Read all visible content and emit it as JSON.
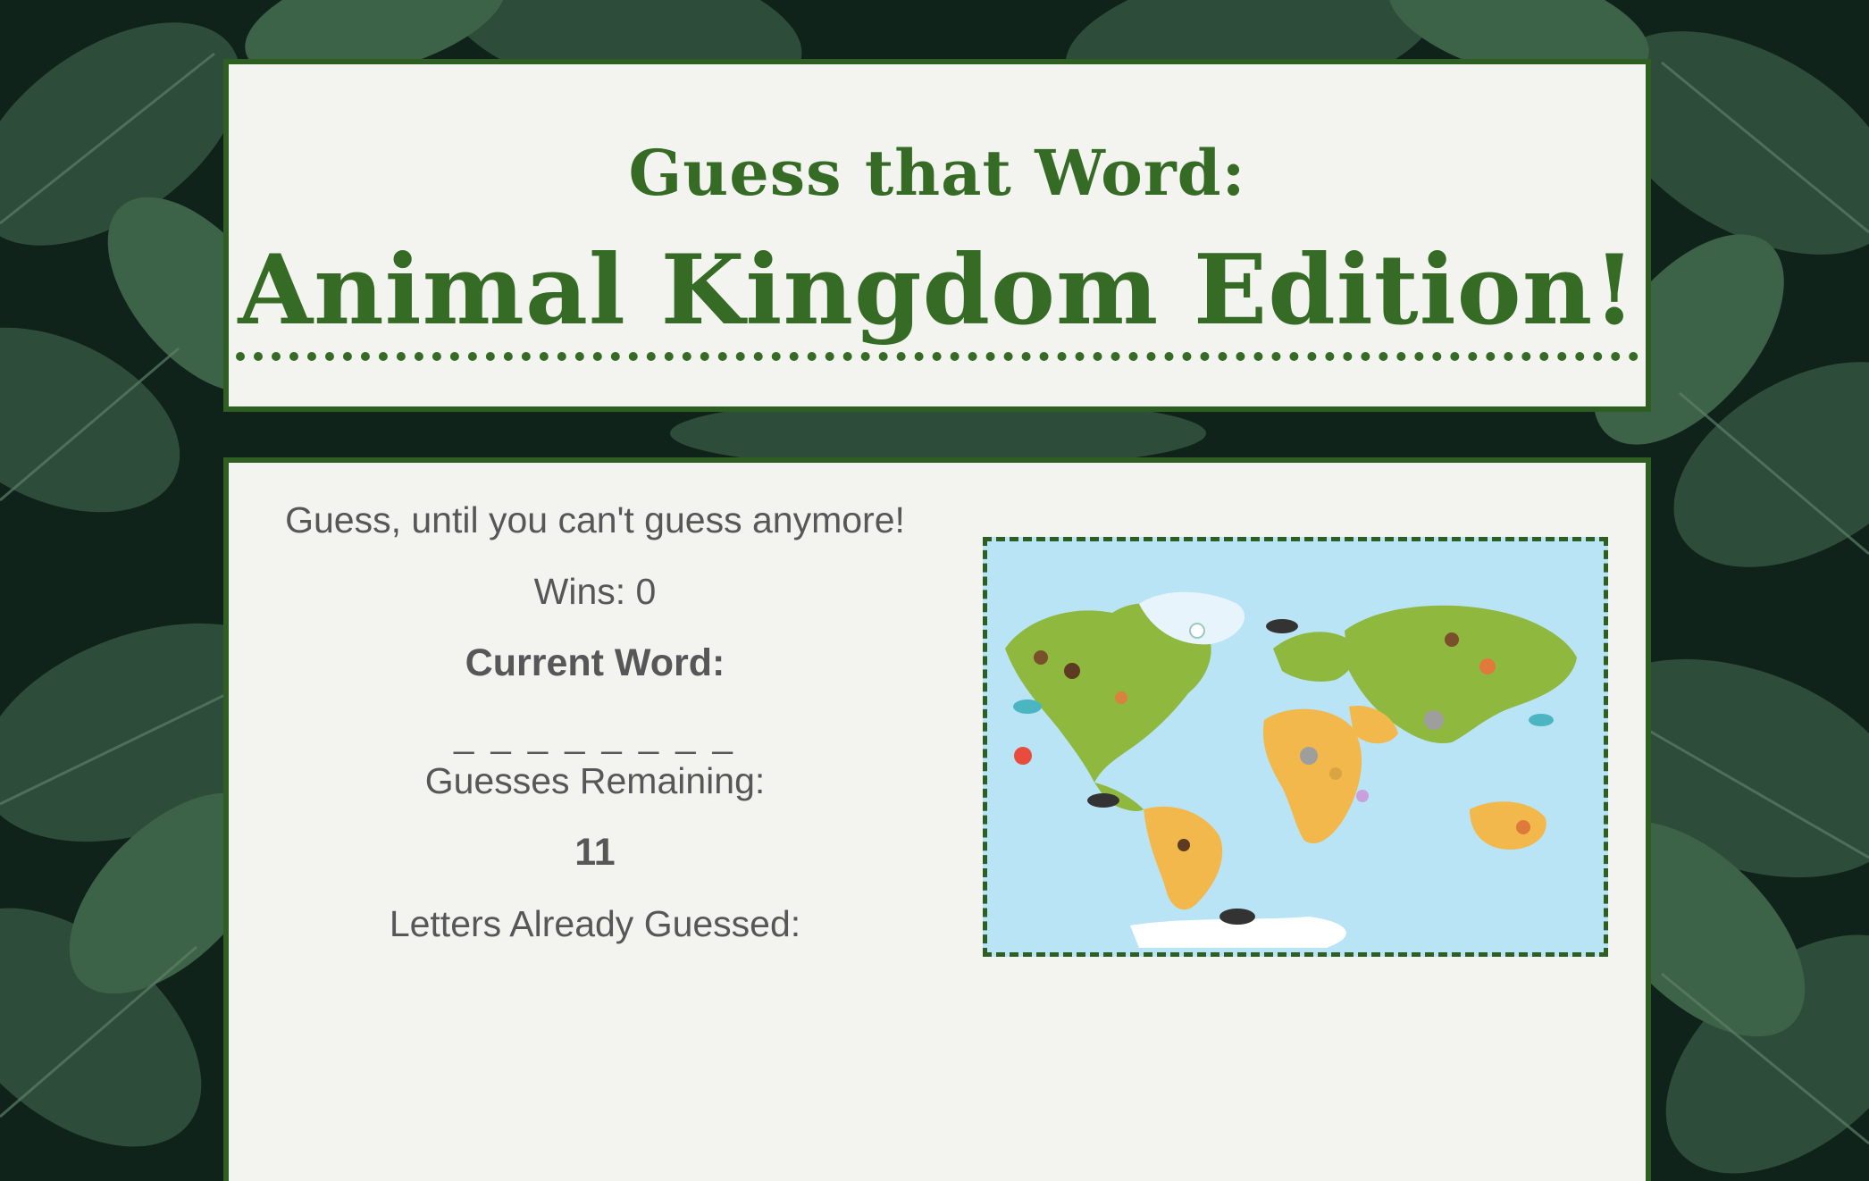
{
  "header": {
    "subtitle": "Guess that Word:",
    "title": "Animal Kingdom Edition!"
  },
  "game": {
    "instructions": "Guess, until you can't guess anymore!",
    "wins_label": "Wins:",
    "wins_value": "0",
    "current_word_label": "Current Word:",
    "word_blanks": "_ _ _ _ _ _ _ _",
    "guesses_remaining_label": "Guesses Remaining:",
    "guesses_remaining_value": "11",
    "letters_guessed_label": "Letters Already Guessed:",
    "letters_guessed": ""
  },
  "image": {
    "icon": "world-animal-map",
    "ocean_color": "#b9e4f6",
    "land_color": "#8fb83f",
    "desert_color": "#f2b84b"
  },
  "theme": {
    "panel_background": "#f3f4ef",
    "border_color": "#2f5e23",
    "title_color": "#356b25",
    "text_color": "#575757"
  }
}
